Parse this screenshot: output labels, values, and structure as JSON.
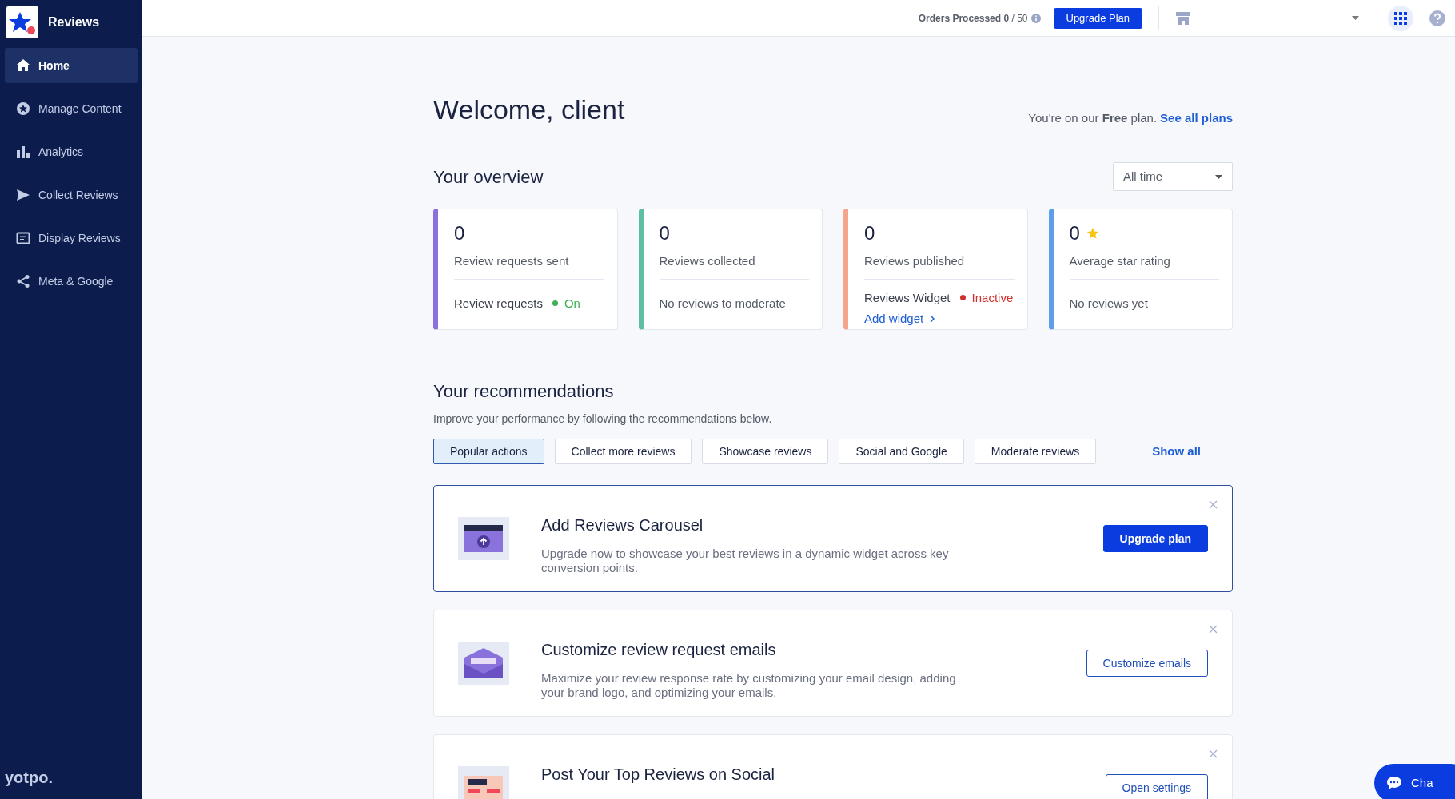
{
  "topbar": {
    "orders_label": "Orders Processed",
    "orders_count": "0",
    "orders_limit": "/ 50",
    "upgrade_button": "Upgrade Plan"
  },
  "sidebar": {
    "title": "Reviews",
    "brand": "yotpo.",
    "items": [
      {
        "label": "Home",
        "kind": "home",
        "selected": true
      },
      {
        "label": "Manage Content",
        "kind": "content",
        "selected": false
      },
      {
        "label": "Analytics",
        "kind": "analytics",
        "selected": false
      },
      {
        "label": "Collect Reviews",
        "kind": "collect",
        "selected": false
      },
      {
        "label": "Display Reviews",
        "kind": "display",
        "selected": false
      },
      {
        "label": "Meta & Google",
        "kind": "social",
        "selected": false
      }
    ]
  },
  "header": {
    "title": "Welcome, client",
    "plan_text": "You're on our **Free** plan.",
    "plan_link": "See all plans"
  },
  "overview": {
    "title": "Your overview",
    "range": "All time",
    "cards": [
      {
        "value": "0",
        "star": false,
        "label": "Review requests sent",
        "color": "#8a72dc",
        "footer": {
          "kind": "status",
          "text": "Review requests",
          "status": {
            "text": "On",
            "color": "#3cb054"
          }
        }
      },
      {
        "value": "0",
        "star": false,
        "label": "Reviews collected",
        "color": "#5cbfa4",
        "footer": {
          "kind": "text",
          "text": "No reviews to moderate"
        }
      },
      {
        "value": "0",
        "star": false,
        "label": "Reviews published",
        "color": "#f7a58a",
        "footer": {
          "kind": "status",
          "text": "Reviews Widget",
          "status": {
            "text": "Inactive",
            "color": "#d0312d"
          },
          "link": "Add widget"
        }
      },
      {
        "value": "0",
        "star": true,
        "label": "Average star rating",
        "color": "#5c9eea",
        "footer": {
          "kind": "text",
          "text": "No reviews yet"
        }
      }
    ]
  },
  "recommendations": {
    "title": "Your recommendations",
    "subtitle": "Improve your performance by following the recommendations below.",
    "show_all": "Show all",
    "tabs": [
      {
        "label": "Popular actions",
        "selected": true
      },
      {
        "label": "Collect more reviews",
        "selected": false
      },
      {
        "label": "Showcase reviews",
        "selected": false
      },
      {
        "label": "Social and Google",
        "selected": false
      },
      {
        "label": "Moderate reviews",
        "selected": false
      }
    ],
    "items": [
      {
        "kind": "carousel",
        "highlighted": true,
        "title": "Add Reviews Carousel",
        "description": "Upgrade now to showcase your best reviews in a dynamic widget across key conversion points.",
        "button": {
          "label": "Upgrade plan",
          "kind": "primary"
        }
      },
      {
        "kind": "email",
        "highlighted": false,
        "title": "Customize review request emails",
        "description": "Maximize your review response rate by customizing your email design, adding your brand logo, and optimizing your emails.",
        "button": {
          "label": "Customize emails",
          "kind": "outline"
        }
      },
      {
        "kind": "social",
        "highlighted": false,
        "title": "Post Your Top Reviews on Social",
        "button": {
          "label": "Open settings",
          "kind": "outline"
        }
      }
    ]
  },
  "chat": {
    "label": "Cha"
  }
}
